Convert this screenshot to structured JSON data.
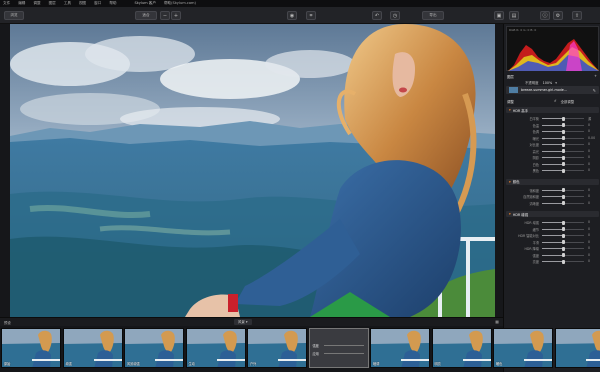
{
  "menubar": {
    "items": [
      "文件",
      "编辑",
      "调整",
      "图层",
      "工具",
      "视图",
      "窗口",
      "帮助"
    ],
    "title": "Skylum 客户",
    "account": "帮助(Skylum.com)"
  },
  "toolbar": {
    "left_button": "浏览",
    "zoom_label": "适合",
    "undo_icon": "undo-icon",
    "compare_icon": "compare-icon",
    "export_label": "导出"
  },
  "panel": {
    "histogram_info": "RGB  R: 0  G: 0  B: 0",
    "layers_label": "图层",
    "opacity_label": "不透明度",
    "opacity_value": "100%",
    "layer_name": "breeze-summer-girl-mode...",
    "adjust_label": "调整",
    "adjust_all": "全部调整",
    "sections": [
      {
        "title": "HDR 高手",
        "sliders": [
          {
            "label": "白平衡",
            "value": "源",
            "pos": 0.5
          },
          {
            "label": "色温",
            "value": "0",
            "pos": 0.5
          },
          {
            "label": "色调",
            "value": "0",
            "pos": 0.5
          },
          {
            "label": "曝光",
            "value": "0.00",
            "pos": 0.5
          },
          {
            "label": "对比度",
            "value": "0",
            "pos": 0.5
          },
          {
            "label": "高光",
            "value": "0",
            "pos": 0.5
          },
          {
            "label": "阴影",
            "value": "0",
            "pos": 0.5
          },
          {
            "label": "白色",
            "value": "0",
            "pos": 0.5
          },
          {
            "label": "黑色",
            "value": "0",
            "pos": 0.5
          }
        ]
      },
      {
        "title": "颜色",
        "sliders": [
          {
            "label": "饱和度",
            "value": "0",
            "pos": 0.5
          },
          {
            "label": "自然饱和度",
            "value": "0",
            "pos": 0.5
          },
          {
            "label": "清晰度",
            "value": "0",
            "pos": 0.5
          }
        ]
      },
      {
        "title": "HDR 增强",
        "sliders": [
          {
            "label": "HDR 增强",
            "value": "0",
            "pos": 0.5
          },
          {
            "label": "细节",
            "value": "0",
            "pos": 0.5
          },
          {
            "label": "HDR 智能对比",
            "value": "0",
            "pos": 0.5
          },
          {
            "label": "平滑",
            "value": "0",
            "pos": 0.5
          },
          {
            "label": "HDR 降噪",
            "value": "0",
            "pos": 0.5
          },
          {
            "label": "强度",
            "value": "0",
            "pos": 0.5
          },
          {
            "label": "亮度",
            "value": "0",
            "pos": 0.5
          }
        ]
      }
    ]
  },
  "filmstrip": {
    "bar_left": "预设",
    "bar_center": "风景 ▾",
    "thumbnails": [
      "原始",
      "增强",
      "风景增强",
      "生动",
      "户外",
      "戏剧性",
      "暗调",
      "明亮",
      "暖色",
      ""
    ],
    "selected_index": 5,
    "selected_labels": [
      "强度",
      "应用"
    ]
  }
}
